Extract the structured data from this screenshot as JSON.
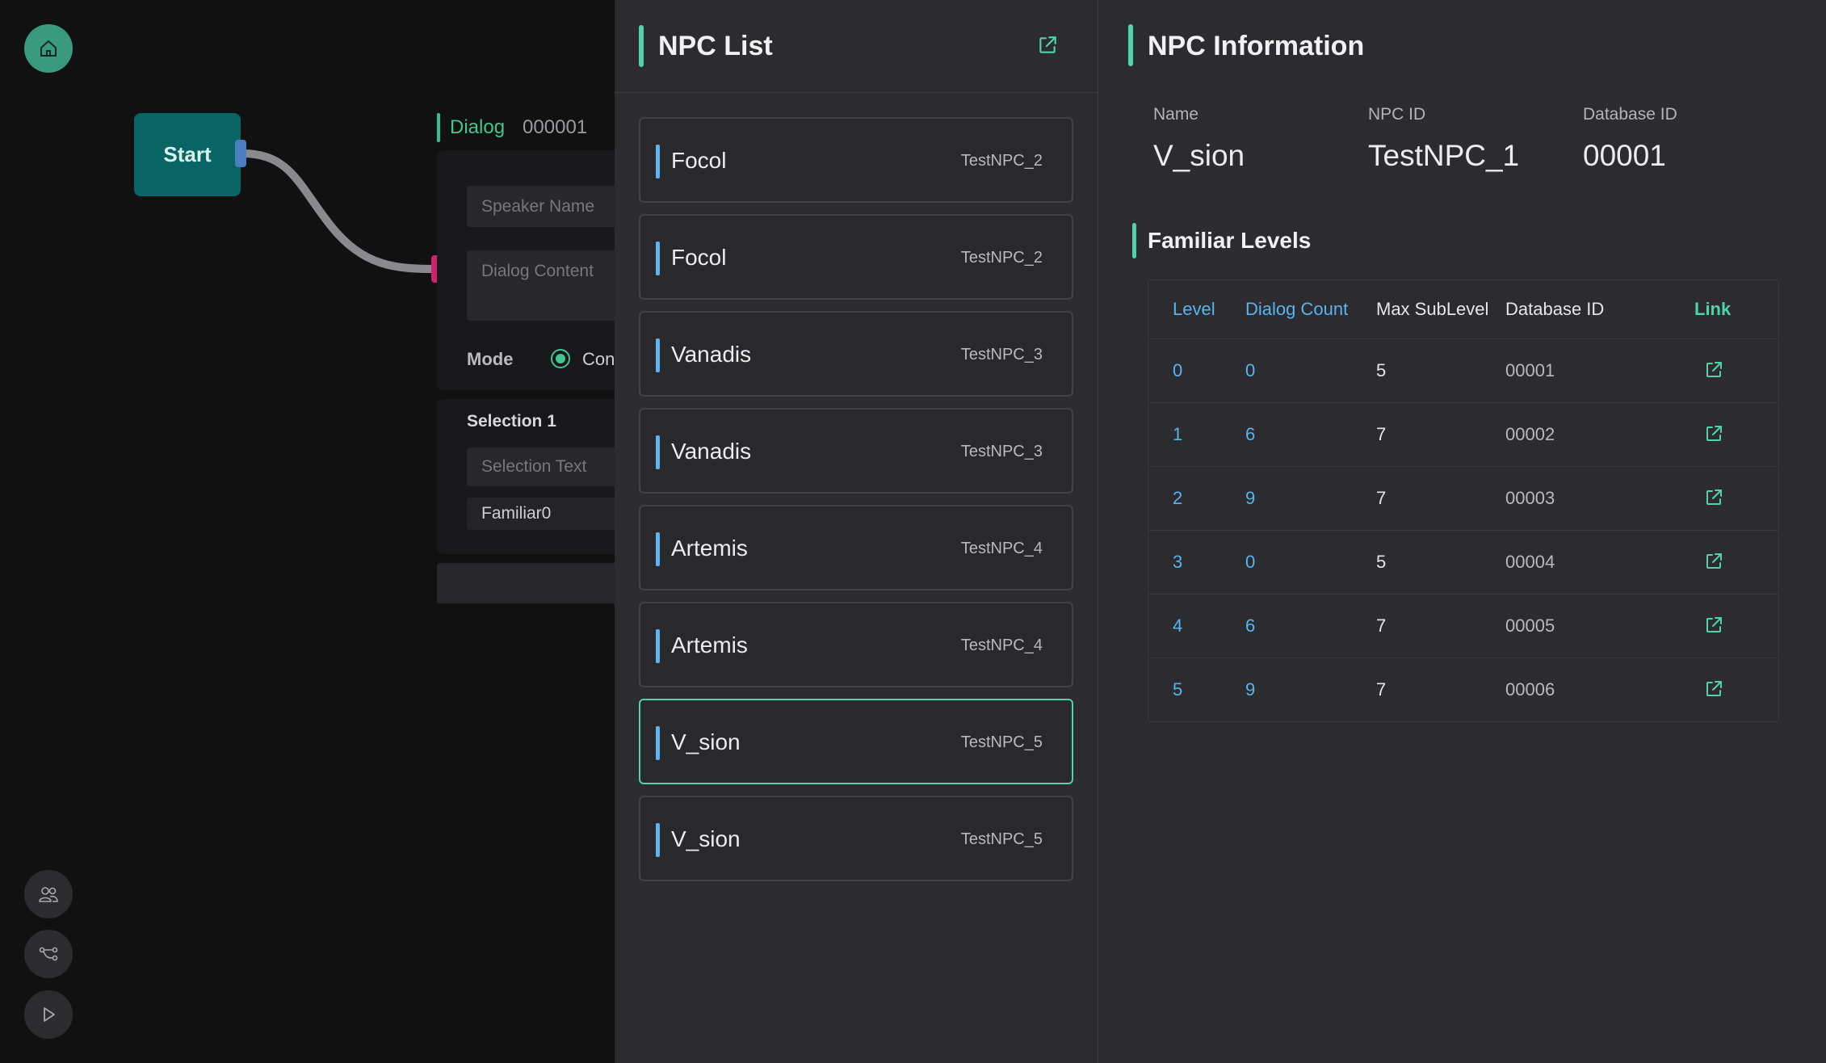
{
  "canvas": {
    "start_node_label": "Start",
    "dialog_node": {
      "title": "Dialog",
      "id": "000001",
      "speaker_placeholder": "Speaker Name",
      "content_placeholder": "Dialog Content",
      "mode_label": "Mode",
      "mode_option": "Con"
    },
    "selection": {
      "title": "Selection 1",
      "text_placeholder": "Selection Text",
      "familiar_value": "Familiar0"
    },
    "connector_color": "#8a8a8e",
    "tools": [
      "people-icon",
      "graph-icon",
      "play-icon"
    ]
  },
  "npc_list": {
    "title": "NPC List",
    "items": [
      {
        "name": "Focol",
        "id": "TestNPC_2",
        "selected": false
      },
      {
        "name": "Focol",
        "id": "TestNPC_2",
        "selected": false
      },
      {
        "name": "Vanadis",
        "id": "TestNPC_3",
        "selected": false
      },
      {
        "name": "Vanadis",
        "id": "TestNPC_3",
        "selected": false
      },
      {
        "name": "Artemis",
        "id": "TestNPC_4",
        "selected": false
      },
      {
        "name": "Artemis",
        "id": "TestNPC_4",
        "selected": false
      },
      {
        "name": "V_sion",
        "id": "TestNPC_5",
        "selected": true
      },
      {
        "name": "V_sion",
        "id": "TestNPC_5",
        "selected": false
      }
    ]
  },
  "npc_info": {
    "title": "NPC Information",
    "name_label": "Name",
    "name_value": "V_sion",
    "npc_id_label": "NPC ID",
    "npc_id_value": "TestNPC_1",
    "db_id_label": "Database ID",
    "db_id_value": "00001",
    "familiar_title": "Familiar Levels",
    "table": {
      "headers": [
        "Level",
        "Dialog Count",
        "Max SubLevel",
        "Database ID",
        "Link"
      ],
      "rows": [
        [
          "0",
          "0",
          "5",
          "00001"
        ],
        [
          "1",
          "6",
          "7",
          "00002"
        ],
        [
          "2",
          "9",
          "7",
          "00003"
        ],
        [
          "3",
          "0",
          "5",
          "00004"
        ],
        [
          "4",
          "6",
          "7",
          "00005"
        ],
        [
          "5",
          "9",
          "7",
          "00006"
        ]
      ]
    }
  },
  "colors": {
    "accent": "#4fd3a7",
    "level_blue": "#58b4ee",
    "panel_bg": "#2c2c30",
    "canvas_bg": "#111112"
  }
}
